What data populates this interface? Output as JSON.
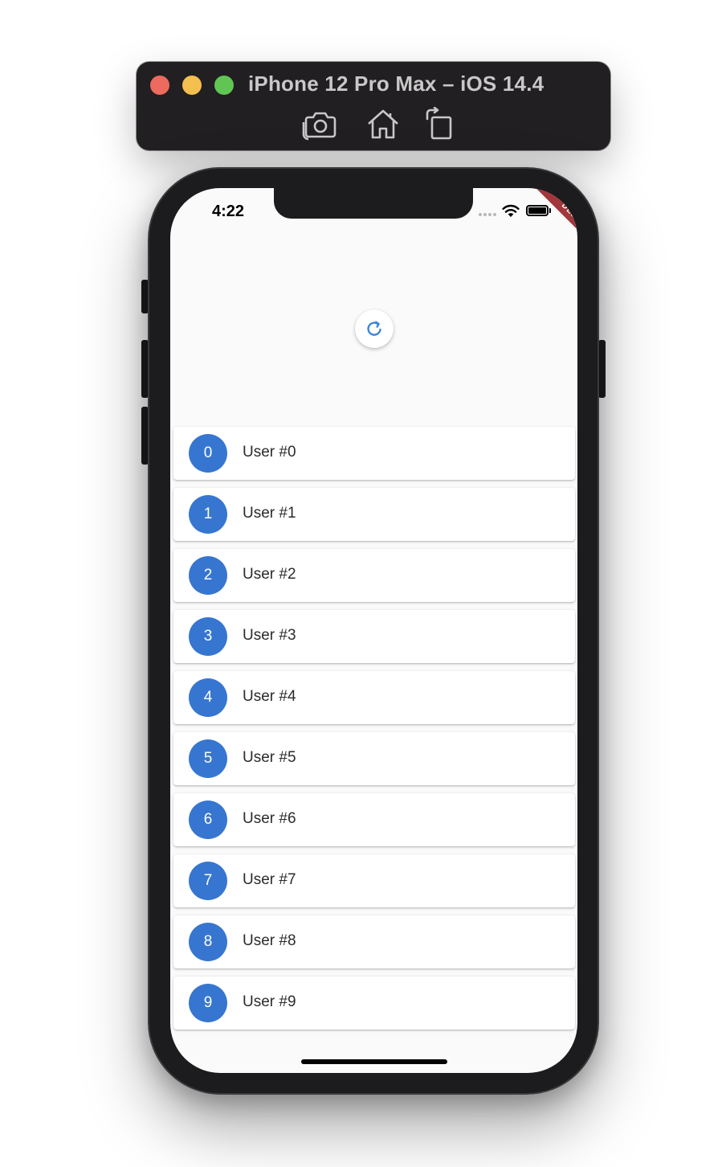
{
  "simulator": {
    "title": "iPhone 12 Pro Max – iOS 14.4",
    "buttons": [
      "screenshot",
      "home",
      "rotate"
    ]
  },
  "status_bar": {
    "time": "4:22",
    "debug_banner": "DEBUG"
  },
  "colors": {
    "avatar": "#3776d0",
    "refresh_indicator": "#3a85d8",
    "debug_ribbon": "#a1373c"
  },
  "list": {
    "items": [
      {
        "index": "0",
        "label": "User #0"
      },
      {
        "index": "1",
        "label": "User #1"
      },
      {
        "index": "2",
        "label": "User #2"
      },
      {
        "index": "3",
        "label": "User #3"
      },
      {
        "index": "4",
        "label": "User #4"
      },
      {
        "index": "5",
        "label": "User #5"
      },
      {
        "index": "6",
        "label": "User #6"
      },
      {
        "index": "7",
        "label": "User #7"
      },
      {
        "index": "8",
        "label": "User #8"
      },
      {
        "index": "9",
        "label": "User #9"
      }
    ]
  }
}
